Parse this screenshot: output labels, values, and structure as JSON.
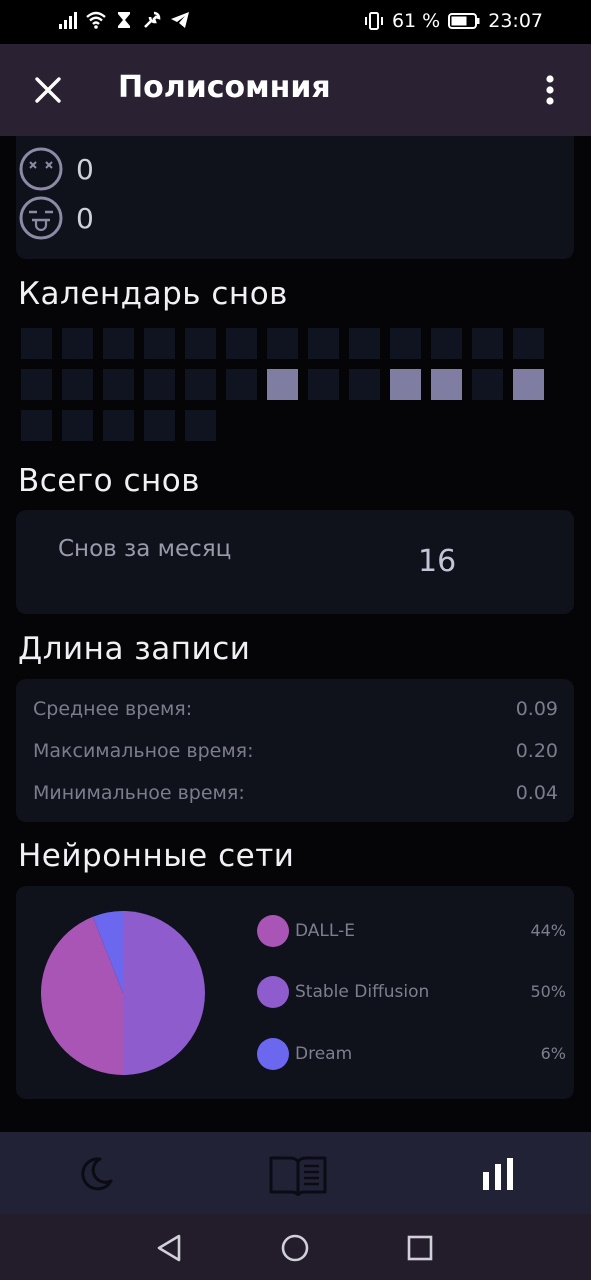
{
  "status_bar": {
    "battery_percent": "61 %",
    "time": "23:07",
    "icons": [
      "signal-icon",
      "wifi-icon",
      "hourglass-icon",
      "tool-icon",
      "telegram-icon",
      "vibrate-icon",
      "battery-icon"
    ]
  },
  "app_bar": {
    "title": "Полисомния",
    "icons": [
      "close-icon",
      "more-vertical-icon"
    ]
  },
  "emotions": [
    {
      "icon": "dizzy-face-icon",
      "count": "0"
    },
    {
      "icon": "tongue-face-icon",
      "count": "0"
    }
  ],
  "calendar": {
    "heading": "Календарь снов",
    "days_with_dreams": [
      19,
      22,
      23,
      25
    ],
    "total_days": 31,
    "colors": {
      "empty": "#101320",
      "filled": "#7f7ea2"
    }
  },
  "total": {
    "heading": "Всего снов",
    "label": "Снов за месяц",
    "value": "16"
  },
  "record_length": {
    "heading": "Длина записи",
    "rows": [
      {
        "label": "Среднее время:",
        "value": "0.09"
      },
      {
        "label": "Максимальное время:",
        "value": "0.20"
      },
      {
        "label": "Минимальное время:",
        "value": "0.04"
      }
    ]
  },
  "networks": {
    "heading": "Нейронные сети",
    "legend": [
      {
        "name": "DALL-E",
        "percent": "44%",
        "color": "#a855b5"
      },
      {
        "name": "Stable Diffusion",
        "percent": "50%",
        "color": "#8e5ccc"
      },
      {
        "name": "Dream",
        "percent": "6%",
        "color": "#6b68ef"
      }
    ]
  },
  "chart_data": {
    "type": "pie",
    "categories": [
      "DALL-E",
      "Stable Diffusion",
      "Dream"
    ],
    "values": [
      44,
      50,
      6
    ],
    "colors": [
      "#a855b5",
      "#8e5ccc",
      "#6b68ef"
    ]
  },
  "bottom_nav": {
    "items": [
      {
        "icon": "moon-icon",
        "active": false
      },
      {
        "icon": "book-icon",
        "active": false
      },
      {
        "icon": "bar-chart-icon",
        "active": true
      }
    ]
  },
  "system_nav": {
    "icons": [
      "back-triangle-icon",
      "home-circle-icon",
      "recents-square-icon"
    ]
  }
}
